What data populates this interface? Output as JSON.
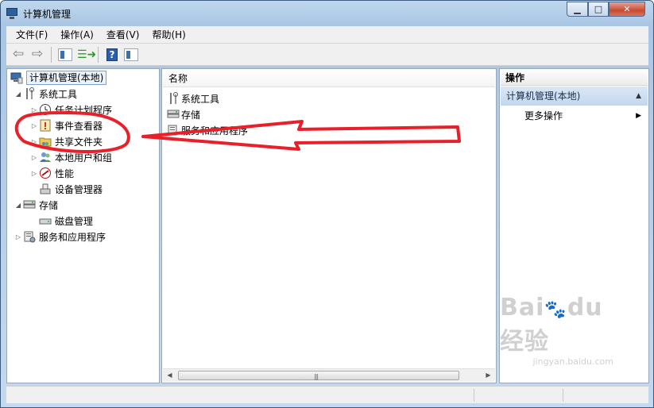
{
  "window": {
    "title": "计算机管理",
    "controls": [
      "minimize",
      "maximize",
      "close"
    ]
  },
  "menu": [
    "文件(F)",
    "操作(A)",
    "查看(V)",
    "帮助(H)"
  ],
  "toolbar": {
    "icons": [
      "back-arrow-icon",
      "forward-arrow-icon",
      "show-hide-tree-icon",
      "export-list-icon",
      "help-icon",
      "action-pane-icon"
    ]
  },
  "tree": {
    "root": "计算机管理(本地)",
    "system_tools": "系统工具",
    "task_scheduler": "任务计划程序",
    "event_viewer": "事件查看器",
    "shared_folders": "共享文件夹",
    "local_users": "本地用户和组",
    "performance": "性能",
    "device_manager": "设备管理器",
    "storage": "存储",
    "disk_management": "磁盘管理",
    "services": "服务和应用程序"
  },
  "list": {
    "header": "名称",
    "rows": [
      "系统工具",
      "存储",
      "服务和应用程序"
    ]
  },
  "actions": {
    "header": "操作",
    "section": "计算机管理(本地)",
    "more": "更多操作"
  },
  "watermark": {
    "brand": "Bai du 经验",
    "url": "jingyan.baidu.com"
  },
  "colors": {
    "annotation_red": "#e8202a",
    "selection_border": "#7da2ce",
    "title_gradient": "#a9c6e4"
  }
}
